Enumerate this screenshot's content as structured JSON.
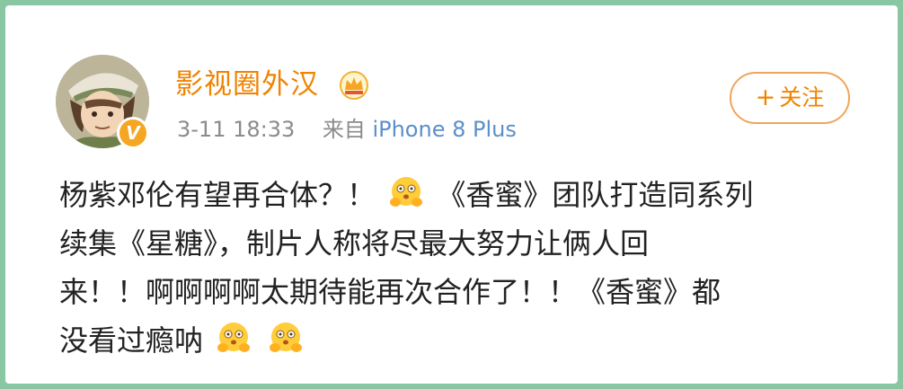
{
  "post": {
    "username": "影视圈外汉",
    "time": "3-11 18:33",
    "from_label": "来自",
    "source": "iPhone 8 Plus",
    "verified_badge": "V",
    "follow_label": "关注",
    "follow_plus": "+",
    "content_lines": [
      [
        "杨紫邓伦有望再合体？！ ",
        "《香蜜》团队打造同系列"
      ],
      [
        "续集《星糖》，制片人称将尽最大努力让俩人回"
      ],
      [
        "来！！啊啊啊啊太期待能再次合作了！！《香蜜》都"
      ],
      [
        "没看过瘾呐 "
      ]
    ],
    "emoji_name": "hug-emoji"
  },
  "colors": {
    "accent": "#f08300",
    "link": "#5b8fc9",
    "frame": "#88c7a1",
    "meta": "#8b8b8b"
  }
}
